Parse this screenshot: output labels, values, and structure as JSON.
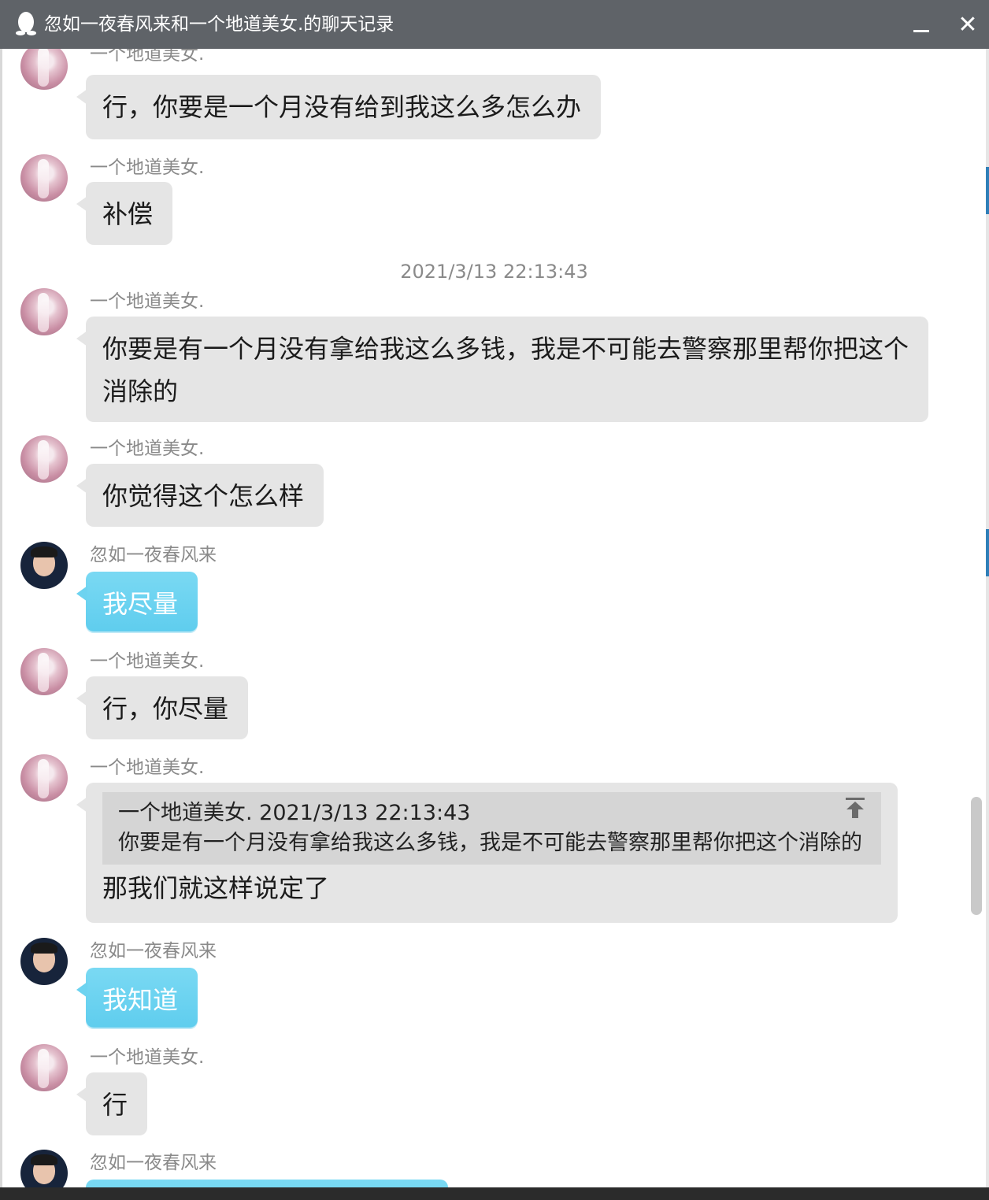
{
  "window": {
    "title": "忽如一夜春风来和一个地道美女.的聊天记录",
    "min_label": "—",
    "close_label": "✕"
  },
  "messages": [
    {
      "sender": "一个地道美女.",
      "text": "行，你要是一个月没有给到我这么多怎么办",
      "mine": false
    },
    {
      "sender": "一个地道美女.",
      "text": "补偿",
      "mine": false
    },
    {
      "timestamp": "2021/3/13 22:13:43"
    },
    {
      "sender": "一个地道美女.",
      "text": "你要是有一个月没有拿给我这么多钱，我是不可能去警察那里帮你把这个消除的",
      "mine": false
    },
    {
      "sender": "一个地道美女.",
      "text": "你觉得这个怎么样",
      "mine": false
    },
    {
      "sender": "忽如一夜春风来",
      "text": "我尽量",
      "mine": true
    },
    {
      "sender": "一个地道美女.",
      "text": "行，你尽量",
      "mine": false
    },
    {
      "sender": "一个地道美女.",
      "quote": {
        "header": "一个地道美女.  2021/3/13 22:13:43",
        "text": "你要是有一个月没有拿给我这么多钱，我是不可能去警察那里帮你把这个消除的"
      },
      "text": "那我们就这样说定了",
      "mine": false
    },
    {
      "sender": "忽如一夜春风来",
      "text": "我知道",
      "mine": true
    },
    {
      "sender": "一个地道美女.",
      "text": "行",
      "mine": false
    },
    {
      "sender": "忽如一夜春风来",
      "text": "",
      "mine": true
    }
  ],
  "colors": {
    "titlebar": "#5f6368",
    "her_bubble": "#e5e5e5",
    "my_bubble": "#6dd3f0",
    "sender_text": "#8a8a8a"
  }
}
